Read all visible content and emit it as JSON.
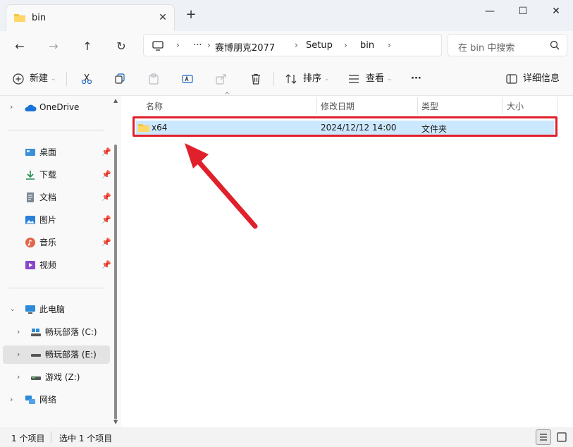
{
  "window": {
    "tab_title": "bin",
    "tab_close": "✕",
    "new_tab": "+",
    "minimize": "—",
    "maximize": "☐",
    "close": "✕"
  },
  "nav": {
    "back": "←",
    "forward": "→",
    "up": "↑",
    "refresh": "↻",
    "breadcrumb_overflow": "···",
    "breadcrumbs": [
      "赛博朋克2077",
      "Setup",
      "bin"
    ],
    "search_placeholder": "在 bin 中搜索"
  },
  "toolbar": {
    "new_label": "新建",
    "sort_label": "排序",
    "view_label": "查看",
    "more_label": "···",
    "details_label": "详细信息"
  },
  "sidebar": {
    "onedrive": "OneDrive",
    "quick_access": [
      {
        "label": "桌面",
        "icon": "desktop-icon"
      },
      {
        "label": "下载",
        "icon": "download-icon"
      },
      {
        "label": "文档",
        "icon": "document-icon"
      },
      {
        "label": "图片",
        "icon": "picture-icon"
      },
      {
        "label": "音乐",
        "icon": "music-icon"
      },
      {
        "label": "视频",
        "icon": "video-icon"
      }
    ],
    "this_pc": "此电脑",
    "drives": [
      {
        "label": "畅玩部落 (C:)"
      },
      {
        "label": "畅玩部落 (E:)"
      },
      {
        "label": "游戏 (Z:)"
      }
    ],
    "network": "网络"
  },
  "columns": {
    "name": "名称",
    "modified": "修改日期",
    "type": "类型",
    "size": "大小"
  },
  "files": [
    {
      "name": "x64",
      "modified": "2024/12/12 14:00",
      "type": "文件夹",
      "size": ""
    }
  ],
  "status": {
    "item_count": "1 个项目",
    "selected": "选中 1 个项目"
  },
  "colors": {
    "selection": "#cce8ff",
    "highlight_border": "#e0202b",
    "arrow": "#e0202b",
    "folder": "#f5c542"
  }
}
